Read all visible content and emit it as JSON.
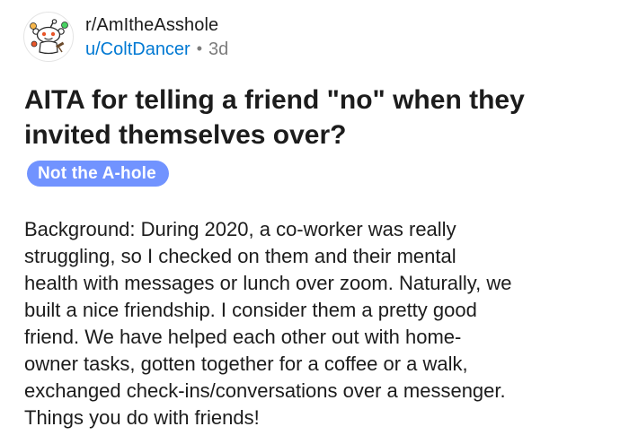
{
  "post": {
    "subreddit": "r/AmItheAsshole",
    "author": "u/ColtDancer",
    "separator": "•",
    "age": "3d",
    "avatar_icon": "snoo-judge-icon",
    "title_line1": "AITA for telling a friend \"no\" when they",
    "title_line2": "invited themselves over?",
    "flair": "Not the A-hole",
    "flair_color": "#7193ff",
    "body_lines": [
      "Background: During 2020, a co-worker was really",
      "struggling, so I checked on them and their mental",
      "health with messages or lunch over zoom. Naturally, we",
      "built a nice friendship. I consider them a pretty good",
      "friend. We have helped each other out with home-",
      "owner tasks, gotten together for a coffee or a walk,",
      "exchanged check-ins/conversations over a messenger.",
      "Things you do with friends!"
    ]
  },
  "colors": {
    "user_link": "#0079d3",
    "muted": "#7c7c7c",
    "text": "#1c1c1c"
  }
}
